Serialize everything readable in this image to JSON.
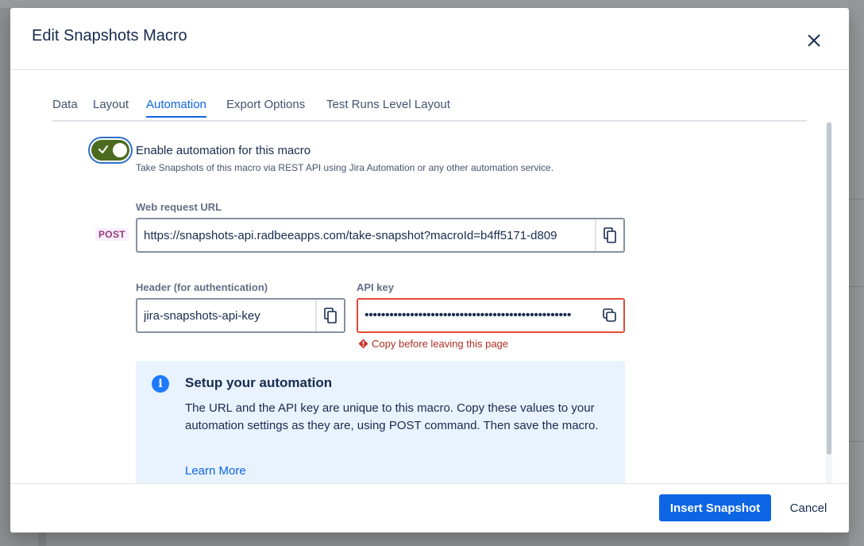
{
  "modal": {
    "title": "Edit Snapshots Macro"
  },
  "tabs": [
    {
      "label": "Data",
      "active": false
    },
    {
      "label": "Layout",
      "active": false
    },
    {
      "label": "Automation",
      "active": true
    },
    {
      "label": "Export Options",
      "active": false
    },
    {
      "label": "Test Runs Level Layout",
      "active": false
    }
  ],
  "automation": {
    "toggle_on": true,
    "enable_label": "Enable automation for this macro",
    "enable_description": "Take Snapshots of this macro via REST API using Jira Automation or any other automation service.",
    "web_request": {
      "label": "Web request URL",
      "method": "POST",
      "value": "https://snapshots-api.radbeeapps.com/take-snapshot?macroId=b4ff5171-d809"
    },
    "header": {
      "label": "Header (for authentication)",
      "value": "jira-snapshots-api-key"
    },
    "api_key": {
      "label": "API key",
      "masked_value": "••••••••••••••••••••••••••••••••••••••••••••••••••",
      "error": "Copy before leaving this page"
    }
  },
  "info": {
    "title": "Setup your automation",
    "body": "The URL and the API key are unique to this macro. Copy these values to your automation settings as they are, using POST command. Then save the macro.",
    "link": "Learn More"
  },
  "footer": {
    "primary": "Insert Snapshot",
    "cancel": "Cancel"
  },
  "colors": {
    "accent": "#0c66e4",
    "toggle": "#4c6b1f",
    "error": "#e34935",
    "info_bg": "#e9f2ff",
    "method_badge": "#943d73"
  },
  "icons": [
    "close-icon",
    "check-icon",
    "copy-icon",
    "copy-icon",
    "copy-icon",
    "error-icon",
    "info-icon"
  ]
}
